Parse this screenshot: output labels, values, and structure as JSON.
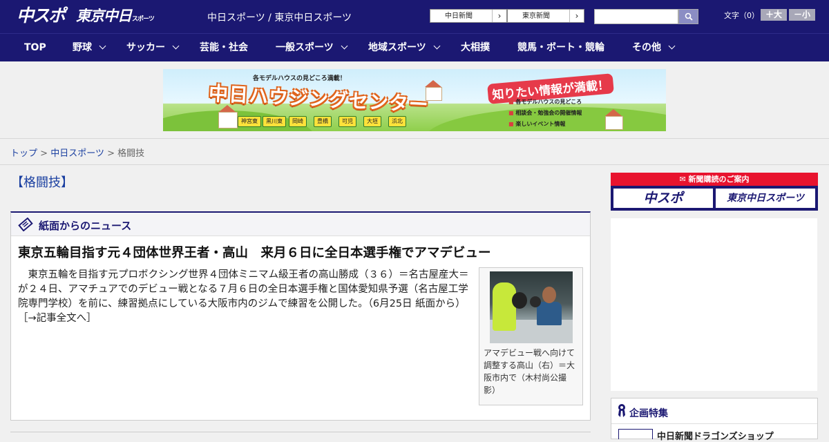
{
  "header": {
    "logo_chuspo": "中スポ",
    "logo_tokyo": "東京中日",
    "logo_tokyo_suffix": "スポーツ",
    "site_title": "中日スポーツ / 東京中日スポーツ",
    "paper_links": [
      {
        "label": "中日新聞"
      },
      {
        "label": "東京新聞"
      }
    ],
    "search": {
      "placeholder": "",
      "value": ""
    },
    "font_size": {
      "label": "文字（0）",
      "larger": "＋大",
      "smaller": "－小"
    }
  },
  "nav": {
    "items": [
      {
        "label": "TOP",
        "has_menu": false
      },
      {
        "label": "野球",
        "has_menu": true
      },
      {
        "label": "サッカー",
        "has_menu": true
      },
      {
        "label": "芸能・社会",
        "has_menu": false
      },
      {
        "label": "一般スポーツ",
        "has_menu": true
      },
      {
        "label": "地域スポーツ",
        "has_menu": true
      },
      {
        "label": "大相撲",
        "has_menu": false
      },
      {
        "label": "競馬・ボート・競輪",
        "has_menu": false
      },
      {
        "label": "その他",
        "has_menu": true
      }
    ]
  },
  "banner": {
    "top_text": "各モデルハウスの見どころ満載！",
    "main_text": "中日ハウジングセンター",
    "right_text": "知りたい情報が満載！",
    "list": [
      "各モデルハウスの見どころ",
      "相談会・勉強会の開催情報",
      "楽しいイベント情報"
    ],
    "tags": [
      "神宮東",
      "黒川東",
      "岡崎",
      "豊橋",
      "可児",
      "大垣",
      "浜北"
    ]
  },
  "breadcrumb": {
    "items": [
      "トップ",
      "中日スポーツ"
    ],
    "current": "格闘技",
    "separator": ">"
  },
  "page": {
    "title": "【格闘技】"
  },
  "news_section": {
    "heading": "紙面からのニュース",
    "article": {
      "title": "東京五輪目指す元４団体世界王者・高山　来月６日に全日本選手権でアマデビュー",
      "body": "東京五輪を目指す元プロボクシング世界４団体ミニマム級王者の高山勝成（３６）＝名古屋産大＝が２４日、アマチュアでのデビュー戦となる７月６日の全日本選手権と国体愛知県予選（名古屋工学院専門学校）を前に、練習拠点にしている大阪市内のジムで練習を公開した。（6月25日 紙面から）",
      "more_link": "［→記事全文へ］",
      "photo_caption": "アマデビュー戦へ向けて調整する高山（右）＝大阪市内で（木村尚公撮影）"
    }
  },
  "sidebar": {
    "subscription": {
      "heading": "新聞購読のご案内",
      "buttons": [
        "中スポ",
        "東京中日スポーツ"
      ]
    },
    "feature": {
      "heading": "企画特集",
      "first_item": "中日新聞ドラゴンズショップ"
    }
  },
  "colors": {
    "header_bg": "#1b1872",
    "accent_red": "#e8132e",
    "link_blue": "#1a3fa0"
  }
}
